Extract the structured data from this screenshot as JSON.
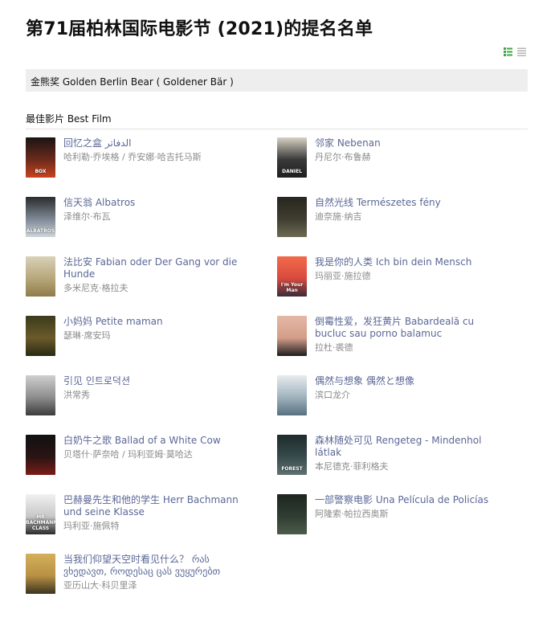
{
  "page": {
    "title": "第71届柏林国际电影节 (2021)的提名名单"
  },
  "view_icons": [
    "list-detail-icon",
    "list-compact-icon"
  ],
  "award": {
    "name": "金熊奖 Golden Berlin Bear ( Goldener Bär )"
  },
  "category": {
    "name": "最佳影片 Best Film"
  },
  "colors": {
    "link": "#5b6796",
    "muted": "#8a8a8a",
    "bar_bg": "#eeeeee",
    "view_icon_active": "#3fa545"
  },
  "films": [
    {
      "title": "回忆之盒 الدفاتر",
      "director": "哈利勒·乔埃格 / 乔安娜·哈吉托马斯"
    },
    {
      "title": "邻家 Nebenan",
      "director": "丹尼尔·布鲁赫"
    },
    {
      "title": "信天翁 Albatros",
      "director": "泽维尔·布瓦"
    },
    {
      "title": "自然光线 Természetes fény",
      "director": "迪奈施·纳吉"
    },
    {
      "title": "法比安 Fabian oder Der Gang vor die Hunde",
      "director": "多米尼克·格拉夫"
    },
    {
      "title": "我是你的人类 Ich bin dein Mensch",
      "director": "玛丽亚·施拉德"
    },
    {
      "title": "小妈妈 Petite maman",
      "director": "瑟琳·席安玛"
    },
    {
      "title": "倒霉性爱，发狂黄片 Babardeală cu bucluc sau porno balamuc",
      "director": "拉杜·裘德"
    },
    {
      "title": "引见 인트로덕션",
      "director": "洪常秀"
    },
    {
      "title": "偶然与想象 偶然と想像",
      "director": "滨口龙介"
    },
    {
      "title": "白奶牛之歌 Ballad of a White Cow",
      "director": "贝塔什·萨奈哈 / 玛利亚姆·莫哈达"
    },
    {
      "title": "森林随处可见 Rengeteg - Mindenhol látlak",
      "director": "本尼德克·菲利格夫"
    },
    {
      "title": "巴赫曼先生和他的学生 Herr Bachmann und seine Klasse",
      "director": "玛利亚·施佩特"
    },
    {
      "title": "一部警察电影 Una Película de Policías",
      "director": "阿隆索·帕拉西奥斯"
    },
    {
      "title": "当我们仰望天空时看见什么？ რას ვხედავთ, როდესაც ცას ვუყურებთ",
      "director": "亚历山大·科贝里泽"
    }
  ],
  "posters": [
    {
      "text": "BOX",
      "colors": [
        "#1a1414",
        "#6b2a1c",
        "#c9421f"
      ]
    },
    {
      "text": "DANIEL",
      "colors": [
        "#d8d2c4",
        "#3a3a3a",
        "#1f1f1f"
      ]
    },
    {
      "text": "ALBATROS",
      "colors": [
        "#2b2b2b",
        "#7d8894",
        "#cfd6da"
      ]
    },
    {
      "text": "",
      "colors": [
        "#27261f",
        "#3f3d30",
        "#6d6a52"
      ]
    },
    {
      "text": "",
      "colors": [
        "#d9d2b8",
        "#b7a77a",
        "#8f7c4a"
      ]
    },
    {
      "text": "I'm Your Man",
      "colors": [
        "#f26b4c",
        "#d94a3d",
        "#3b2b3b"
      ]
    },
    {
      "text": "",
      "colors": [
        "#3a3a1c",
        "#6b5a2a",
        "#2a2a12"
      ]
    },
    {
      "text": "",
      "colors": [
        "#e4b8a6",
        "#d49d89",
        "#1e1e1e"
      ]
    },
    {
      "text": "",
      "colors": [
        "#cfcfcf",
        "#8d8d8d",
        "#3c3c3c"
      ]
    },
    {
      "text": "",
      "colors": [
        "#e8ecef",
        "#9fb3bd",
        "#58707f"
      ]
    },
    {
      "text": "",
      "colors": [
        "#111111",
        "#2a1414",
        "#7a1c16"
      ]
    },
    {
      "text": "FOREST",
      "colors": [
        "#1d2b2b",
        "#374a4c",
        "#5f7273"
      ]
    },
    {
      "text": "MR BACHMANN CLASS",
      "colors": [
        "#f1f1f1",
        "#c8c8c8",
        "#2a2a2a"
      ]
    },
    {
      "text": "",
      "colors": [
        "#1d2620",
        "#2f3d32",
        "#4c5c4a"
      ]
    },
    {
      "text": "",
      "colors": [
        "#d4b05a",
        "#b89144",
        "#3b3420"
      ]
    }
  ]
}
